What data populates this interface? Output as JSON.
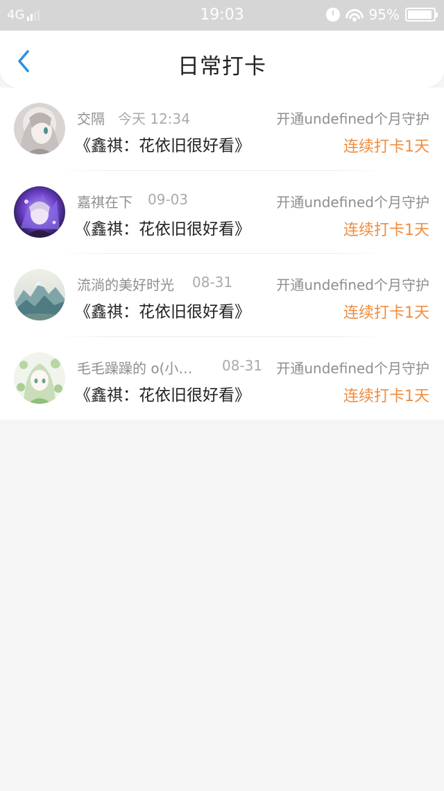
{
  "status_bar": {
    "network": "4G",
    "time": "19:03",
    "battery": "95%",
    "icons": [
      "signal-icon",
      "alarm-icon",
      "wifi-icon",
      "battery-icon"
    ]
  },
  "header": {
    "back_icon": "chevron-left-icon",
    "title": "日常打卡"
  },
  "colors": {
    "accent_blue": "#2f8fe0",
    "streak_orange": "#ef8c3e",
    "muted_text": "#8e8e8e"
  },
  "checkins": [
    {
      "username": "交隔",
      "time": "今天 12:34",
      "guard_text": "开通undefined个月守护",
      "content": "《鑫祺：花依旧很好看》",
      "streak": "连续打卡1天"
    },
    {
      "username": "嘉祺在下",
      "time": "09-03",
      "guard_text": "开通undefined个月守护",
      "content": "《鑫祺：花依旧很好看》",
      "streak": "连续打卡1天"
    },
    {
      "username": "流淌的美好时光",
      "time": "08-31",
      "guard_text": "开通undefined个月守护",
      "content": "《鑫祺：花依旧很好看》",
      "streak": "连续打卡1天"
    },
    {
      "username": "毛毛躁躁的 o(小…",
      "time": "08-31",
      "guard_text": "开通undefined个月守护",
      "content": "《鑫祺：花依旧很好看》",
      "streak": "连续打卡1天"
    }
  ]
}
